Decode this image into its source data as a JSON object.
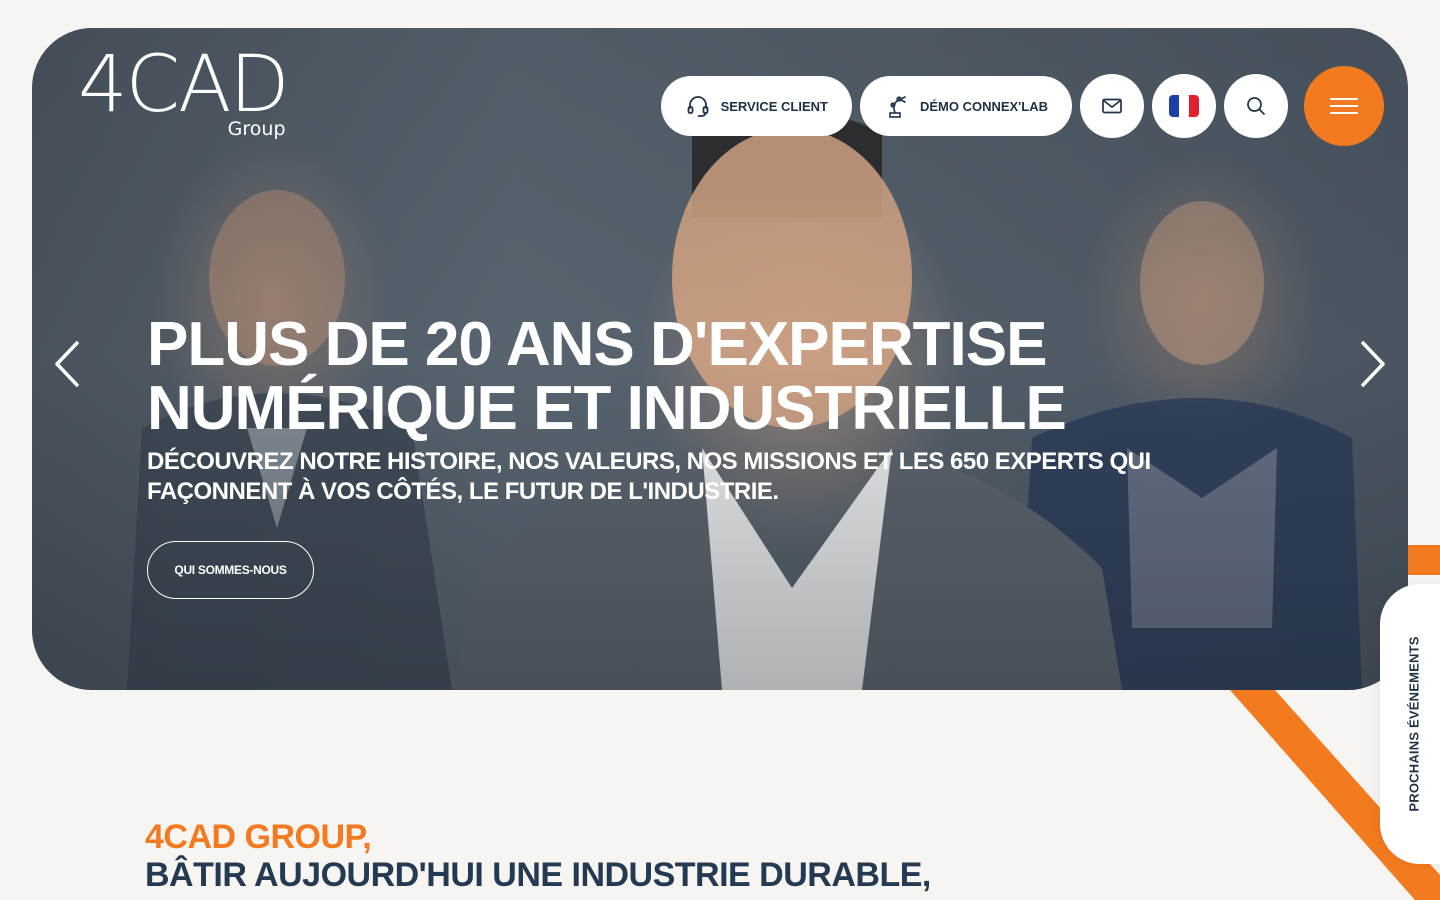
{
  "logo": {
    "main": "4CAD",
    "sub": "Group"
  },
  "header": {
    "service_client": "SERVICE CLIENT",
    "demo_connexlab": "DÉMO CONNEX'LAB"
  },
  "hero": {
    "title_line1": "PLUS DE 20 ANS D'EXPERTISE",
    "title_line2": "NUMÉRIQUE ET INDUSTRIELLE",
    "subtitle_line1": "DÉCOUVREZ NOTRE HISTOIRE, NOS VALEURS, NOS MISSIONS ET LES 650 EXPERTS QUI",
    "subtitle_line2": "FAÇONNENT À VOS CÔTÉS, LE FUTUR DE L'INDUSTRIE.",
    "cta": "QUI SOMMES-NOUS"
  },
  "side_tab": {
    "label": "PROCHAINS ÉVÉNEMENTS"
  },
  "section": {
    "line1": "4CAD GROUP,",
    "line2": "BÂTIR AUJOURD'HUI UNE INDUSTRIE DURABLE,"
  },
  "colors": {
    "accent": "#f47a1f",
    "navy": "#233a52",
    "background": "#f7f5f1"
  },
  "icons": {
    "service_client": "headset-icon",
    "demo": "robot-arm-icon",
    "mail": "mail-icon",
    "language": "french-flag-icon",
    "search": "search-icon",
    "menu": "hamburger-icon",
    "prev": "chevron-left-icon",
    "next": "chevron-right-icon"
  }
}
